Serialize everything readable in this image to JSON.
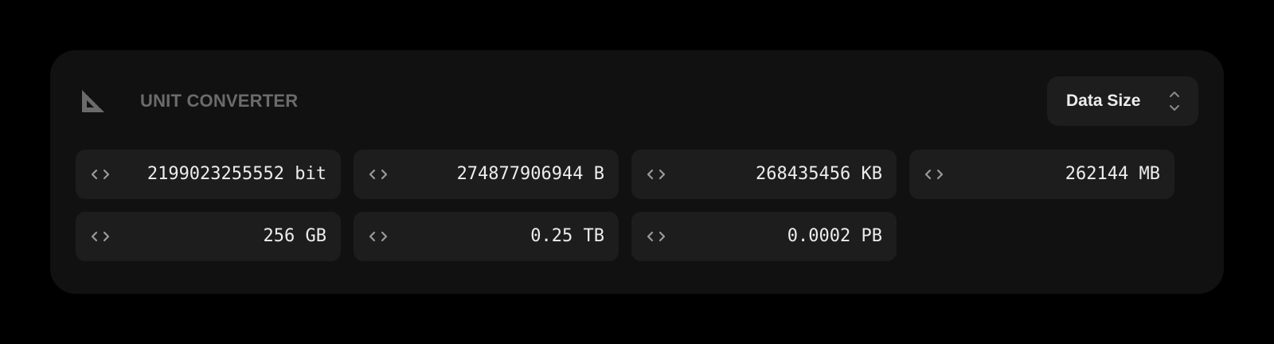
{
  "header": {
    "title": "UNIT CONVERTER",
    "icon": "ruler-triangle-icon"
  },
  "category_select": {
    "selected": "Data Size",
    "icon": "chevron-up-down-icon"
  },
  "conversions": [
    {
      "value": "2199023255552",
      "unit": "bit",
      "display": "2199023255552 bit"
    },
    {
      "value": "274877906944",
      "unit": "B",
      "display": "274877906944 B"
    },
    {
      "value": "268435456",
      "unit": "KB",
      "display": "268435456 KB"
    },
    {
      "value": "262144",
      "unit": "MB",
      "display": "262144 MB"
    },
    {
      "value": "256",
      "unit": "GB",
      "display": "256 GB"
    },
    {
      "value": "0.25",
      "unit": "TB",
      "display": "0.25 TB"
    },
    {
      "value": "0.0002",
      "unit": "PB",
      "display": "0.0002 PB"
    }
  ],
  "colors": {
    "background": "#000000",
    "card": "#111111",
    "field": "#1d1d1d",
    "text": "#ededed",
    "muted": "#6b6b6b"
  }
}
